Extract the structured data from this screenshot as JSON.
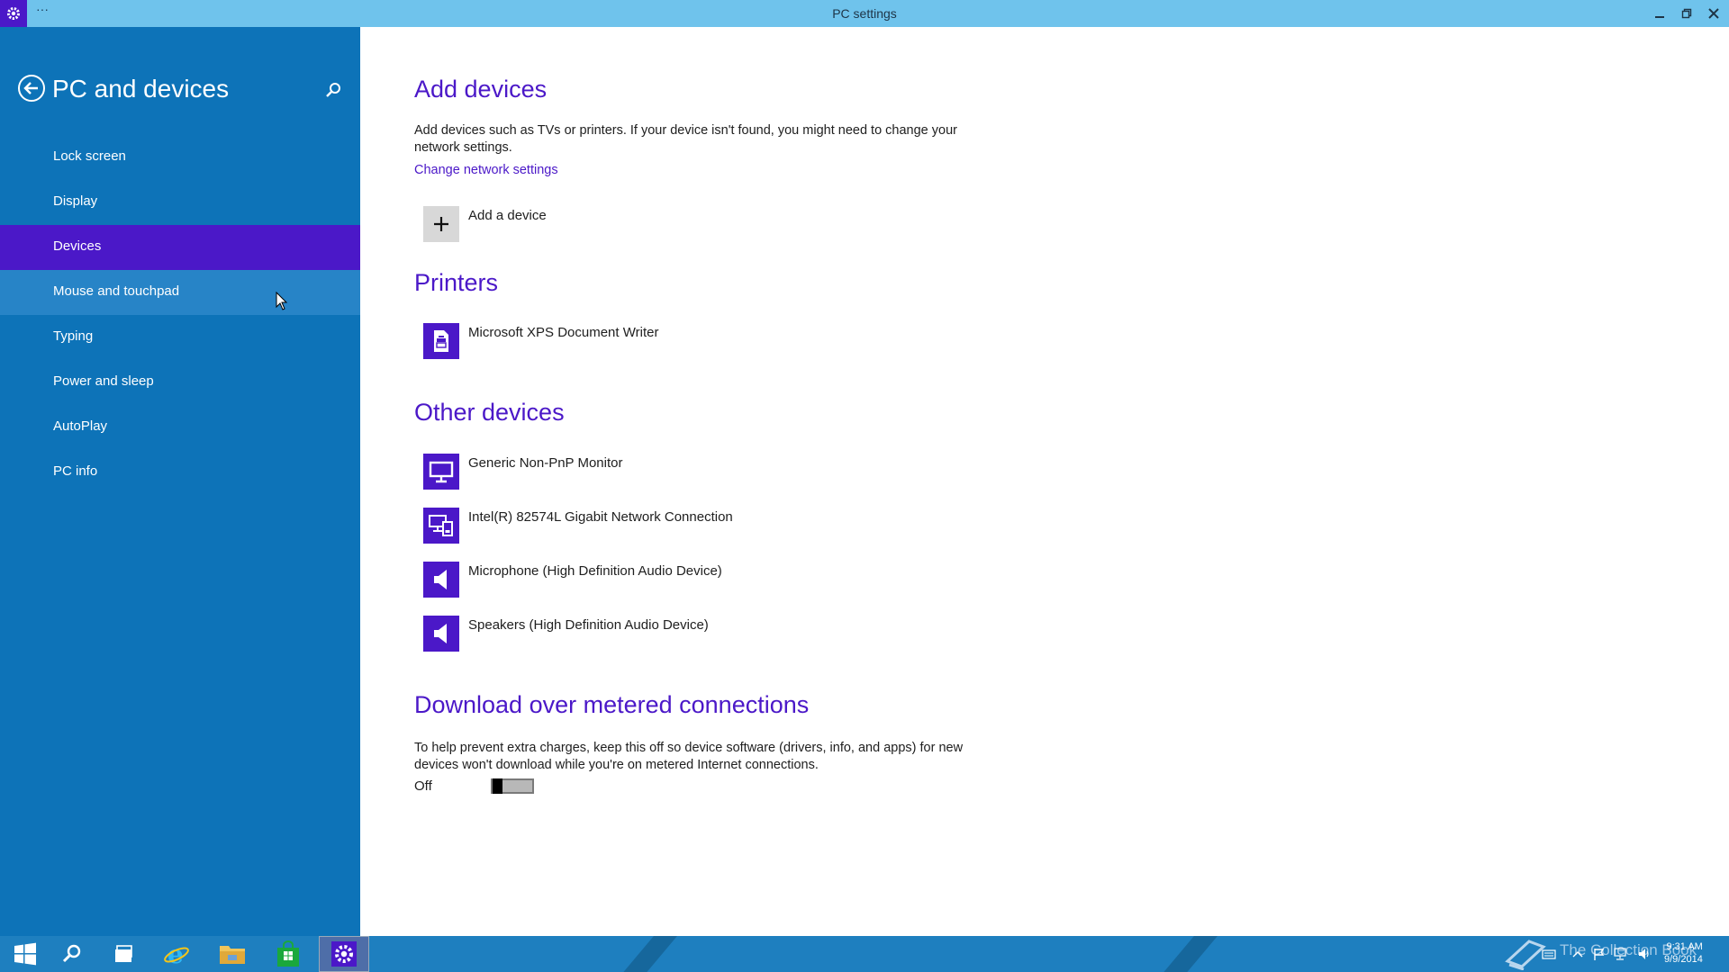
{
  "window": {
    "title": "PC settings",
    "menu_dots": "···",
    "controls": [
      "minimize",
      "restore",
      "close"
    ]
  },
  "sidebar": {
    "title": "PC and devices",
    "items": [
      {
        "label": "Lock screen",
        "state": "normal"
      },
      {
        "label": "Display",
        "state": "normal"
      },
      {
        "label": "Devices",
        "state": "selected"
      },
      {
        "label": "Mouse and touchpad",
        "state": "hover"
      },
      {
        "label": "Typing",
        "state": "normal"
      },
      {
        "label": "Power and sleep",
        "state": "normal"
      },
      {
        "label": "AutoPlay",
        "state": "normal"
      },
      {
        "label": "PC info",
        "state": "normal"
      }
    ]
  },
  "main": {
    "add_devices": {
      "title": "Add devices",
      "description": "Add devices such as TVs or printers. If your device isn't found, you might need to change your network settings.",
      "link": "Change network settings",
      "add_button": "Add a device"
    },
    "printers": {
      "title": "Printers",
      "items": [
        {
          "label": "Microsoft XPS Document Writer",
          "icon": "printer-icon"
        }
      ]
    },
    "other_devices": {
      "title": "Other devices",
      "items": [
        {
          "label": "Generic Non-PnP Monitor",
          "icon": "monitor-icon"
        },
        {
          "label": "Intel(R) 82574L Gigabit Network Connection",
          "icon": "network-icon"
        },
        {
          "label": "Microphone (High Definition Audio Device)",
          "icon": "speaker-icon"
        },
        {
          "label": "Speakers (High Definition Audio Device)",
          "icon": "speaker-icon"
        }
      ]
    },
    "metered": {
      "title": "Download over metered connections",
      "description": "To help prevent extra charges, keep this off so device software (drivers, info, and apps) for new devices won't download while you're on metered Internet connections.",
      "toggle_label": "Off",
      "toggle_on": false
    }
  },
  "taskbar": {
    "watermark": "The Collection Book",
    "time": "9:31 AM",
    "date": "9/9/2014"
  },
  "colors": {
    "accent": "#4b18c8",
    "sidebar": "#0d73b8",
    "titlebar": "#6fc3ec",
    "taskbar": "#1e7fbf"
  }
}
